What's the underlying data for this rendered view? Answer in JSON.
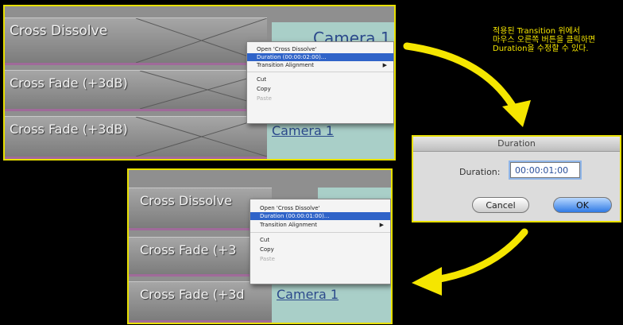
{
  "top_panel": {
    "clips": [
      {
        "label": "Cross Dissolve",
        "camera": "Camera 1"
      },
      {
        "label": "Cross Fade (+3dB)",
        "camera": ""
      },
      {
        "label": "Cross Fade (+3dB)",
        "camera": "Camera 1"
      }
    ],
    "menu": {
      "open": "Open 'Cross Dissolve'",
      "duration": "Duration (00:00:02:00)...",
      "alignment": "Transition Alignment",
      "cut": "Cut",
      "copy": "Copy",
      "paste": "Paste"
    }
  },
  "annotation": {
    "line1": "적용된 Transition 위에서",
    "line2": "마우스 오른쪽 버튼을 클릭하면",
    "line3": "Duration을 수정할 수 있다."
  },
  "dialog": {
    "title": "Duration",
    "field_label": "Duration:",
    "field_value": "00:00:01;00",
    "cancel": "Cancel",
    "ok": "OK"
  },
  "bottom_panel": {
    "clips": [
      {
        "label": "Cross Dissolve",
        "camera": ""
      },
      {
        "label": "Cross Fade (+3",
        "camera": ""
      },
      {
        "label": "Cross Fade (+3d",
        "camera": "Camera 1"
      }
    ],
    "menu": {
      "open": "Open 'Cross Dissolve'",
      "duration": "Duration (00:00:01:00)...",
      "alignment": "Transition Alignment",
      "cut": "Cut",
      "copy": "Copy",
      "paste": "Paste"
    }
  },
  "colors": {
    "highlight": "#e8e000",
    "menu_selected": "#2f63c8",
    "arrow": "#f5e600"
  }
}
